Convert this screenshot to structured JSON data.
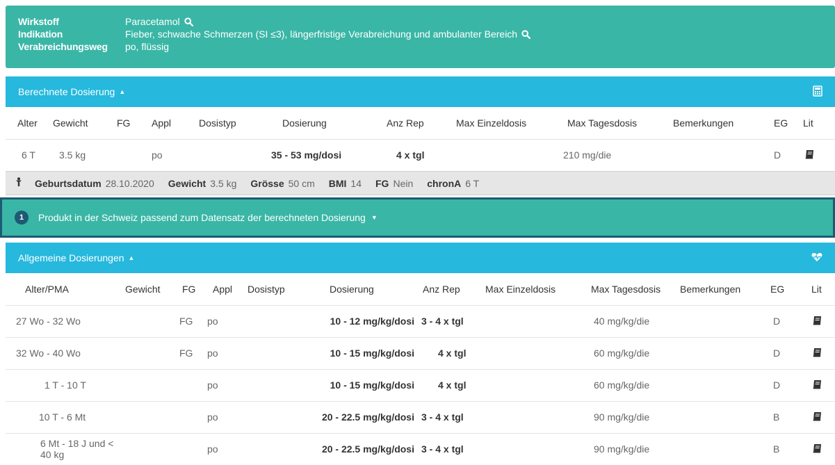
{
  "drug": {
    "wirkstoff_label": "Wirkstoff",
    "wirkstoff_value": "Paracetamol",
    "indikation_label": "Indikation",
    "indikation_value": "Fieber, schwache Schmerzen (SI ≤3), längerfristige Verabreichung und ambulanter Bereich",
    "weg_label": "Verabreichungsweg",
    "weg_value": "po, flüssig"
  },
  "calculated": {
    "title": "Berechnete Dosierung",
    "headers": [
      "Alter",
      "Gewicht",
      "FG",
      "Appl",
      "Dosistyp",
      "Dosierung",
      "Anz Rep",
      "Max Einzeldosis",
      "Max Tagesdosis",
      "Bemerkungen",
      "EG",
      "Lit"
    ],
    "row": {
      "alter": "6 T",
      "gewicht": "3.5 kg",
      "fg": "",
      "appl": "po",
      "dosistyp": "",
      "dosierung": "35 - 53 mg/dosi",
      "anzrep": "4 x tgl",
      "maxeinzel": "",
      "maxtag": "210 mg/die",
      "bemerkungen": "",
      "eg": "D"
    }
  },
  "patient": {
    "geburtsdatum_label": "Geburtsdatum",
    "geburtsdatum_value": "28.10.2020",
    "gewicht_label": "Gewicht",
    "gewicht_value": "3.5 kg",
    "groesse_label": "Grösse",
    "groesse_value": "50 cm",
    "bmi_label": "BMI",
    "bmi_value": "14",
    "fg_label": "FG",
    "fg_value": "Nein",
    "chrona_label": "chronA",
    "chrona_value": "6 T"
  },
  "product": {
    "count": "1",
    "text": "Produkt in der Schweiz passend zum Datensatz der berechneten Dosierung"
  },
  "general": {
    "title": "Allgemeine Dosierungen",
    "headers": [
      "Alter/PMA",
      "Gewicht",
      "FG",
      "Appl",
      "Dosistyp",
      "Dosierung",
      "Anz Rep",
      "Max Einzeldosis",
      "Max Tagesdosis",
      "Bemerkungen",
      "EG",
      "Lit"
    ],
    "rows": [
      {
        "alter": "27 Wo - 32 Wo",
        "gewicht": "",
        "fg": "FG",
        "appl": "po",
        "dosistyp": "",
        "dosierung": "10 - 12 mg/kg/dosi",
        "anzrep": "3 - 4 x tgl",
        "maxeinzel": "",
        "maxtag": "40 mg/kg/die",
        "bemerkungen": "",
        "eg": "D"
      },
      {
        "alter": "32 Wo - 40 Wo",
        "gewicht": "",
        "fg": "FG",
        "appl": "po",
        "dosistyp": "",
        "dosierung": "10 - 15 mg/kg/dosi",
        "anzrep": "4 x tgl",
        "maxeinzel": "",
        "maxtag": "60 mg/kg/die",
        "bemerkungen": "",
        "eg": "D"
      },
      {
        "alter": "1 T - 10 T",
        "gewicht": "",
        "fg": "",
        "appl": "po",
        "dosistyp": "",
        "dosierung": "10 - 15 mg/kg/dosi",
        "anzrep": "4 x tgl",
        "maxeinzel": "",
        "maxtag": "60 mg/kg/die",
        "bemerkungen": "",
        "eg": "D"
      },
      {
        "alter": "10 T - 6 Mt",
        "gewicht": "",
        "fg": "",
        "appl": "po",
        "dosistyp": "",
        "dosierung": "20 - 22.5 mg/kg/dosi",
        "anzrep": "3 - 4 x tgl",
        "maxeinzel": "",
        "maxtag": "90 mg/kg/die",
        "bemerkungen": "",
        "eg": "B"
      },
      {
        "alter": "6 Mt - 18 J und < 40 kg",
        "gewicht": "",
        "fg": "",
        "appl": "po",
        "dosistyp": "",
        "dosierung": "20 - 22.5 mg/kg/dosi",
        "anzrep": "3 - 4 x tgl",
        "maxeinzel": "",
        "maxtag": "90 mg/kg/die",
        "bemerkungen": "",
        "eg": "B"
      }
    ]
  },
  "colors": {
    "teal": "#3ab6a6",
    "cyan": "#26b8dd",
    "navy": "#1d5a74"
  }
}
